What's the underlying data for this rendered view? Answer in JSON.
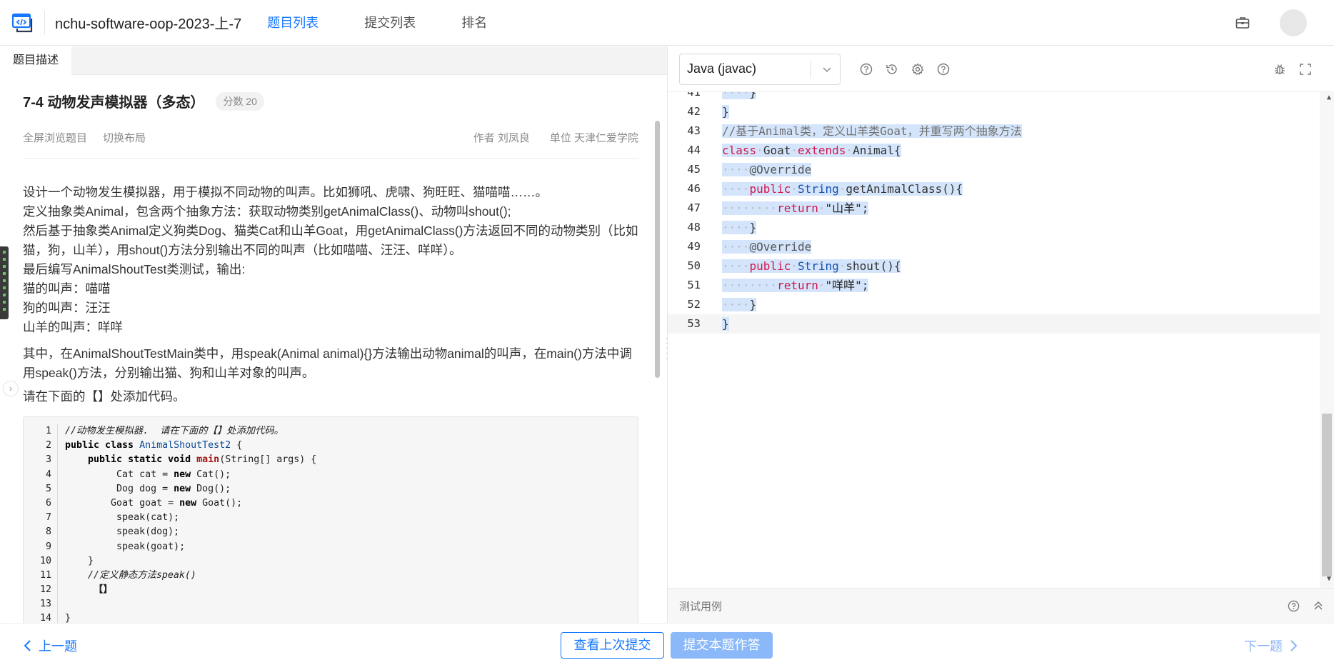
{
  "header": {
    "contest_title": "nchu-software-oop-2023-上-7",
    "nav": [
      {
        "label": "题目列表",
        "active": true
      },
      {
        "label": "提交列表",
        "active": false
      },
      {
        "label": "排名",
        "active": false
      }
    ],
    "accent_color": "#1677ff"
  },
  "left_panel": {
    "tab_label": "题目描述",
    "problem_title": "7-4 动物发声模拟器（多态）",
    "score_badge": "分数 20",
    "fullscreen_link": "全屏浏览题目",
    "switch_layout_link": "切换布局",
    "author": "作者 刘凤良",
    "unit": "单位 天津仁爱学院",
    "description": [
      "设计一个动物发生模拟器，用于模拟不同动物的叫声。比如狮吼、虎啸、狗旺旺、猫喵喵……。",
      "定义抽象类Animal，包含两个抽象方法：获取动物类别getAnimalClass()、动物叫shout();",
      "然后基于抽象类Animal定义狗类Dog、猫类Cat和山羊Goat，用getAnimalClass()方法返回不同的动物类别（比如猫，狗，山羊），用shout()方法分别输出不同的叫声（比如喵喵、汪汪、咩咩）。",
      "最后编写AnimalShoutTest类测试，输出:",
      "猫的叫声：喵喵",
      "狗的叫声：汪汪",
      "山羊的叫声：咩咩",
      "其中，在AnimalShoutTestMain类中，用speak(Animal animal){}方法输出动物animal的叫声，在main()方法中调用speak()方法，分别输出猫、狗和山羊对象的叫声。",
      "请在下面的【】处添加代码。"
    ],
    "code_sample": [
      "//动物发生模拟器.  请在下面的【】处添加代码。",
      "public class AnimalShoutTest2 {",
      "    public static void main(String[] args) {",
      "         Cat cat = new Cat();",
      "         Dog dog = new Dog();",
      "        Goat goat = new Goat();",
      "         speak(cat);",
      "         speak(dog);",
      "         speak(goat);",
      "    }",
      "    //定义静态方法speak()",
      "     【】",
      "",
      "}"
    ]
  },
  "editor": {
    "language": "Java (javac)",
    "first_visible_line": 41,
    "lines": [
      "    }",
      "}",
      "//基于Animal类，定义山羊类Goat，并重写两个抽象方法",
      "class Goat extends Animal{",
      "    @Override",
      "    public String getAnimalClass(){",
      "        return \"山羊\";",
      "    }",
      "    @Override",
      "    public String shout(){",
      "        return \"咩咩\";",
      "    }",
      "}"
    ],
    "testcase_label": "测试用例"
  },
  "footer": {
    "prev_label": "上一题",
    "view_last_label": "查看上次提交",
    "submit_label": "提交本题作答",
    "next_label": "下一题"
  }
}
